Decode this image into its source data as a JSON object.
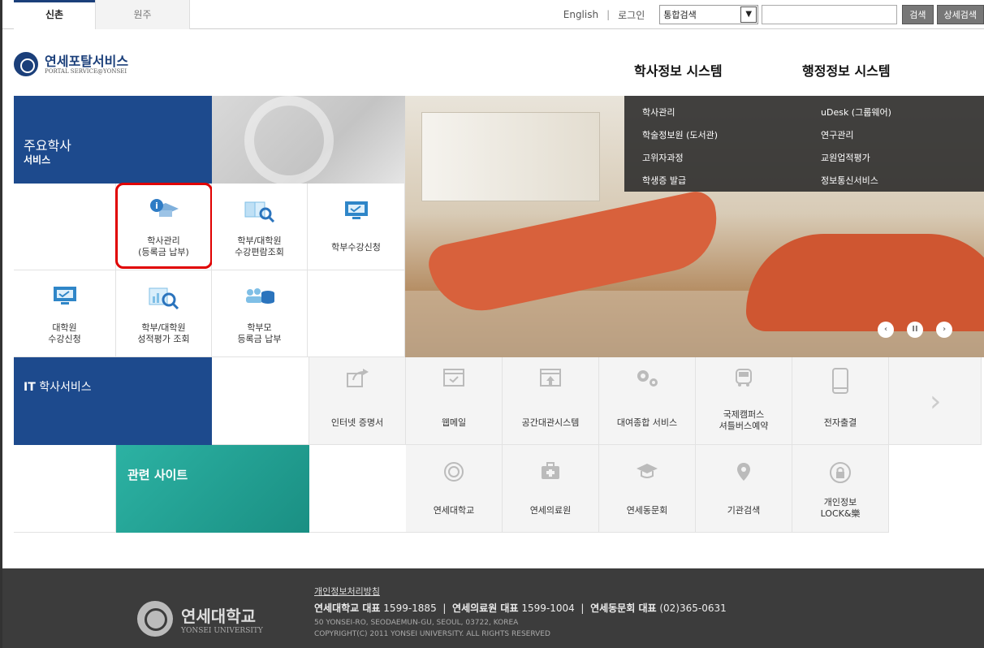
{
  "topbar": {
    "campus_tabs": [
      "신촌",
      "원주"
    ],
    "english": "English",
    "separator": "|",
    "login": "로그인",
    "search_select": "통합검색",
    "search_placeholder": "",
    "search_button": "검색",
    "advanced_search_button": "상세검색"
  },
  "header": {
    "logo_title": "연세포탈서비스",
    "logo_subtitle": "PORTAL SERVICE@YONSEI",
    "nav": [
      "학사정보 시스템",
      "행정정보 시스템"
    ]
  },
  "hero": {
    "title": "주요학사",
    "subtitle": "서비스"
  },
  "dropdown": {
    "academic": [
      "학사관리",
      "학술정보원 (도서관)",
      "고위자과정",
      "학생증 발급"
    ],
    "admin": [
      "uDesk (그룹웨어)",
      "연구관리",
      "교원업적평가",
      "정보통신서비스"
    ]
  },
  "main_tiles": [
    {
      "line1": "학사관리",
      "line2": "(등록금 납부)",
      "icon": "graduation-info-icon"
    },
    {
      "line1": "학부/대학원",
      "line2": "수강편람조회",
      "icon": "book-search-icon"
    },
    {
      "line1": "학부수강신청",
      "line2": "",
      "icon": "monitor-check-icon"
    },
    {
      "line1": "대학원",
      "line2": "수강신청",
      "icon": "monitor-check-icon"
    },
    {
      "line1": "학부/대학원",
      "line2": "성적평가 조회",
      "icon": "chart-search-icon"
    },
    {
      "line1": "학부모",
      "line2": "등록금 납부",
      "icon": "people-coins-icon"
    }
  ],
  "slider": {
    "prev": "‹",
    "pause": "II",
    "next": "›"
  },
  "it_section": {
    "title_bold": "IT",
    "title_rest": "학사서비스",
    "services": [
      {
        "label": "인터넷 증명서",
        "label2": "",
        "icon": "share-icon"
      },
      {
        "label": "웹메일",
        "label2": "",
        "icon": "mail-check-icon"
      },
      {
        "label": "공간대관시스템",
        "label2": "",
        "icon": "upload-box-icon"
      },
      {
        "label": "대여종합 서비스",
        "label2": "",
        "icon": "gears-icon"
      },
      {
        "label": "국제캠퍼스",
        "label2": "셔틀버스예약",
        "icon": "bus-icon"
      },
      {
        "label": "전자출결",
        "label2": "",
        "icon": "mobile-icon"
      }
    ],
    "next": "›"
  },
  "related": {
    "title": "관련 사이트",
    "sites": [
      {
        "label": "연세대학교",
        "label2": "",
        "icon": "yonsei-emblem-icon"
      },
      {
        "label": "연세의료원",
        "label2": "",
        "icon": "medical-kit-icon"
      },
      {
        "label": "연세동문회",
        "label2": "",
        "icon": "graduation-cap-icon"
      },
      {
        "label": "기관검색",
        "label2": "",
        "icon": "location-pin-icon"
      },
      {
        "label": "개인정보",
        "label2": "LOCK&樂",
        "icon": "lock-icon"
      }
    ]
  },
  "footer": {
    "logo_title": "연세대학교",
    "logo_subtitle": "YONSEI UNIVERSITY",
    "policy": "개인정보처리방침",
    "phones": [
      {
        "label": "연세대학교 대표",
        "number": "1599-1885"
      },
      {
        "label": "연세의료원 대표",
        "number": "1599-1004"
      },
      {
        "label": "연세동문회 대표",
        "number": "(02)365-0631"
      }
    ],
    "address": "50 YONSEI-RO, SEODAEMUN-GU, SEOUL, 03722, KOREA",
    "copyright": "COPYRIGHT(C) 2011 YONSEI UNIVERSITY. ALL RIGHTS RESERVED"
  }
}
